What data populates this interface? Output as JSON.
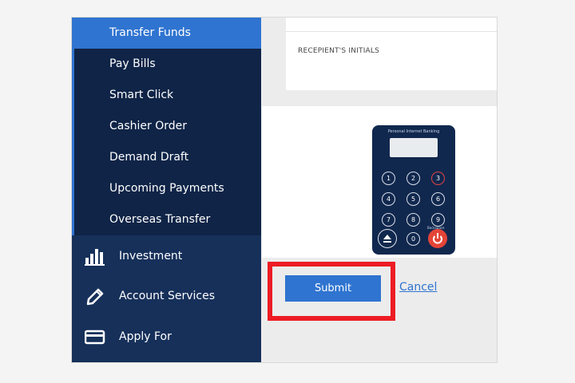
{
  "submenu": {
    "items": [
      {
        "label": "Transfer Funds",
        "active": true
      },
      {
        "label": "Pay Bills"
      },
      {
        "label": "Smart Click"
      },
      {
        "label": "Cashier Order"
      },
      {
        "label": "Demand Draft"
      },
      {
        "label": "Upcoming Payments"
      },
      {
        "label": "Overseas Transfer"
      }
    ]
  },
  "nav": {
    "investment": {
      "label": "Investment",
      "icon": "bar-chart-icon"
    },
    "account_services": {
      "label": "Account Services",
      "icon": "pencil-icon"
    },
    "apply_for": {
      "label": "Apply For",
      "icon": "card-icon"
    }
  },
  "form": {
    "recipient_initials_label": "RECEPIENT'S INITIALS"
  },
  "token_device": {
    "title": "Personal Internet Banking",
    "keys": [
      "1",
      "2",
      "3",
      "4",
      "5",
      "6",
      "7",
      "8",
      "9",
      "0"
    ],
    "backspace_label": "Backspace"
  },
  "actions": {
    "submit_label": "Submit",
    "cancel_label": "Cancel"
  },
  "colors": {
    "sidebar_dark": "#0f2447",
    "sidebar": "#16305a",
    "accent": "#2f74d0",
    "highlight": "#ed1c24"
  }
}
